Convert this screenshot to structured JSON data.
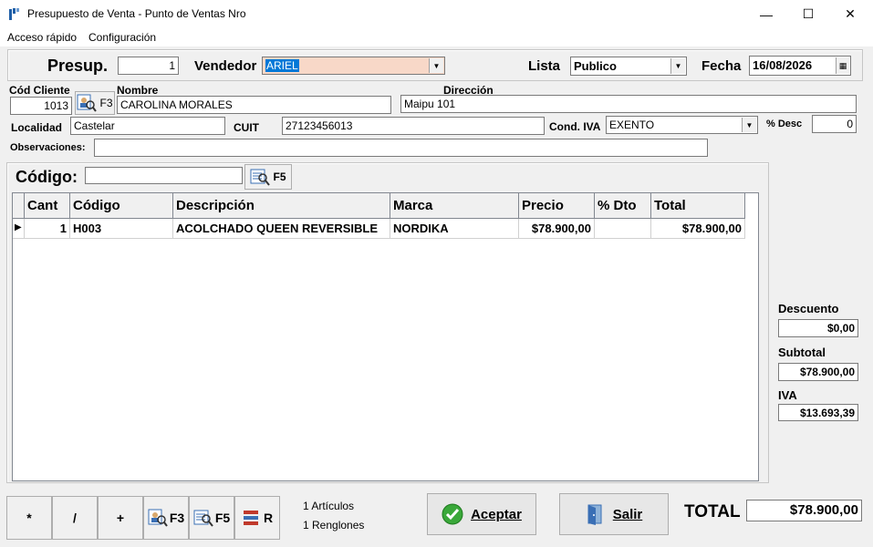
{
  "window": {
    "title": "Presupuesto de Venta -  Punto de Ventas Nro",
    "minimize": "—",
    "maximize": "☐",
    "close": "✕"
  },
  "menu": [
    "Acceso rápido",
    "Configuración"
  ],
  "header": {
    "presup_label": "Presup.",
    "presup_value": "1",
    "vendedor_label": "Vendedor",
    "vendedor_value": "ARIEL",
    "lista_label": "Lista",
    "lista_value": "Publico",
    "fecha_label": "Fecha",
    "fecha_value": "16/08/2026"
  },
  "client": {
    "cod_label": "Cód Cliente",
    "cod_value": "1013",
    "f3_label": "F3",
    "nombre_label": "Nombre",
    "nombre_value": "CAROLINA MORALES",
    "direccion_label": "Dirección",
    "direccion_value": "Maipu 101",
    "localidad_label": "Localidad",
    "localidad_value": "Castelar",
    "cuit_label": "CUIT",
    "cuit_value": "27123456013",
    "condiva_label": "Cond. IVA",
    "condiva_value": "EXENTO",
    "desc_label": "% Desc",
    "desc_value": "0",
    "obs_label": "Observaciones:",
    "obs_value": ""
  },
  "code": {
    "label": "Código:",
    "value": "",
    "f5_label": "F5"
  },
  "grid": {
    "columns": [
      "Cant",
      "Código",
      "Descripción",
      "Marca",
      "Precio",
      "% Dto",
      "Total"
    ],
    "rows": [
      {
        "cant": "1",
        "codigo": "H003",
        "descripcion": "ACOLCHADO QUEEN REVERSIBLE",
        "marca": "NORDIKA",
        "precio": "$78.900,00",
        "dto": "",
        "total": "$78.900,00"
      }
    ]
  },
  "totals": {
    "descuento_label": "Descuento",
    "descuento_value": "$0,00",
    "subtotal_label": "Subtotal",
    "subtotal_value": "$78.900,00",
    "iva_label": "IVA",
    "iva_value": "$13.693,39",
    "total_label": "TOTAL",
    "total_value": "$78.900,00"
  },
  "footer": {
    "btn_mult": "*",
    "btn_div": "/",
    "btn_plus": "+",
    "btn_f3": "F3",
    "btn_f5": "F5",
    "btn_r": "R",
    "articulos": "1 Artículos",
    "renglones": "1 Renglones",
    "aceptar_label": "Aceptar",
    "salir_label": "Salir"
  },
  "colors": {
    "accent": "#0078d7",
    "vendedor_bg": "#f8d8c8",
    "ok_green": "#3aa83a"
  }
}
